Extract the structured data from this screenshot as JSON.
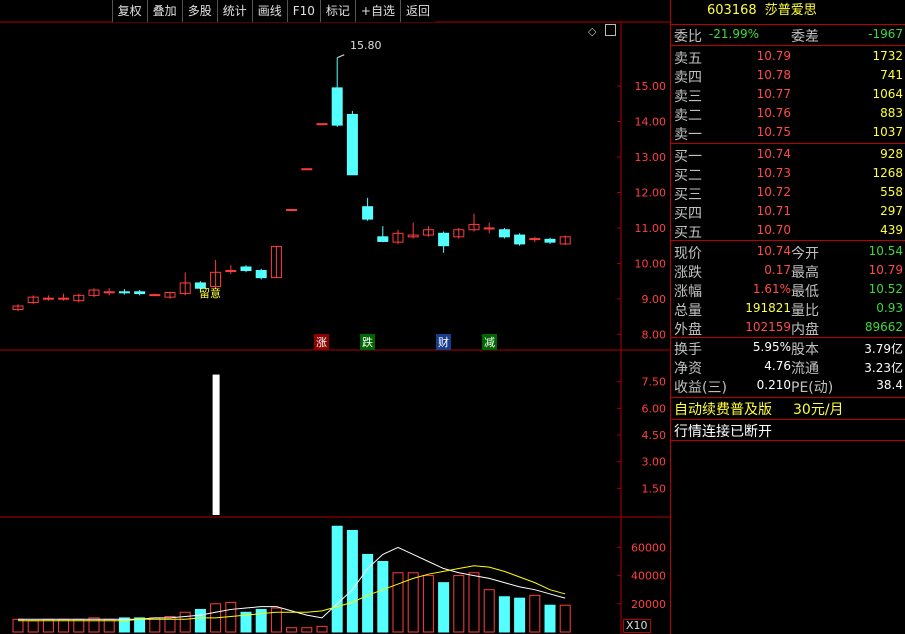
{
  "toolbar": {
    "items": [
      "复权",
      "叠加",
      "多股",
      "统计",
      "画线",
      "F10",
      "标记",
      "+自选",
      "返回"
    ]
  },
  "stock": {
    "code": "603168",
    "name": "莎普爱思"
  },
  "order_ratio": {
    "label": "委比",
    "value": "-21.99%",
    "diff_label": "委差",
    "diff_value": "-1967"
  },
  "asks": [
    {
      "label": "卖五",
      "price": "10.79",
      "vol": "1732"
    },
    {
      "label": "卖四",
      "price": "10.78",
      "vol": "741"
    },
    {
      "label": "卖三",
      "price": "10.77",
      "vol": "1064"
    },
    {
      "label": "卖二",
      "price": "10.76",
      "vol": "883"
    },
    {
      "label": "卖一",
      "price": "10.75",
      "vol": "1037"
    }
  ],
  "bids": [
    {
      "label": "买一",
      "price": "10.74",
      "vol": "928"
    },
    {
      "label": "买二",
      "price": "10.73",
      "vol": "1268"
    },
    {
      "label": "买三",
      "price": "10.72",
      "vol": "558"
    },
    {
      "label": "买四",
      "price": "10.71",
      "vol": "297"
    },
    {
      "label": "买五",
      "price": "10.70",
      "vol": "439"
    }
  ],
  "quote": [
    {
      "l1": "现价",
      "v1": "10.74",
      "c1": "red",
      "l2": "今开",
      "v2": "10.54",
      "c2": "green"
    },
    {
      "l1": "涨跌",
      "v1": "0.17",
      "c1": "red",
      "l2": "最高",
      "v2": "10.79",
      "c2": "red"
    },
    {
      "l1": "涨幅",
      "v1": "1.61%",
      "c1": "red",
      "l2": "最低",
      "v2": "10.52",
      "c2": "green"
    },
    {
      "l1": "总量",
      "v1": "191821",
      "c1": "yellow",
      "l2": "量比",
      "v2": "0.93",
      "c2": "green"
    },
    {
      "l1": "外盘",
      "v1": "102159",
      "c1": "red",
      "l2": "内盘",
      "v2": "89662",
      "c2": "green"
    }
  ],
  "fundamentals": [
    {
      "l1": "换手",
      "v1": "5.95%",
      "l2": "股本",
      "v2": "3.79亿"
    },
    {
      "l1": "净资",
      "v1": "4.76",
      "l2": "流通",
      "v2": "3.23亿"
    },
    {
      "l1": "收益(三)",
      "v1": "0.210",
      "l2": "PE(动)",
      "v2": "38.4"
    }
  ],
  "promo": {
    "text": "自动续费普及版",
    "price": "30元/月"
  },
  "status": {
    "text": "行情连接已断开"
  },
  "annotations": {
    "high_label": "15.80",
    "attention_label": "留意",
    "x10": "X10",
    "tags": [
      "涨",
      "跌",
      "财",
      "减"
    ]
  },
  "colors": {
    "up": "#ff3c3c",
    "down": "#54ffff",
    "ma1": "#ffffff",
    "ma2": "#ffff00",
    "border": "#b00000"
  },
  "chart_data": [
    {
      "type": "candlestick",
      "yticks": [
        "8.00",
        "9.00",
        "10.00",
        "11.00",
        "12.00",
        "13.00",
        "14.00",
        "15.00"
      ],
      "ylim": [
        7.7,
        16.3
      ],
      "candles": [
        {
          "o": 8.7,
          "c": 8.8,
          "h": 8.85,
          "l": 8.65
        },
        {
          "o": 8.9,
          "c": 9.05,
          "h": 9.1,
          "l": 8.85
        },
        {
          "o": 9.0,
          "c": 9.02,
          "h": 9.1,
          "l": 8.95
        },
        {
          "o": 9.02,
          "c": 9.02,
          "h": 9.15,
          "l": 8.95
        },
        {
          "o": 8.95,
          "c": 9.1,
          "h": 9.15,
          "l": 8.9
        },
        {
          "o": 9.1,
          "c": 9.25,
          "h": 9.3,
          "l": 9.05
        },
        {
          "o": 9.2,
          "c": 9.2,
          "h": 9.3,
          "l": 9.1
        },
        {
          "o": 9.2,
          "c": 9.18,
          "h": 9.28,
          "l": 9.12
        },
        {
          "o": 9.2,
          "c": 9.15,
          "h": 9.25,
          "l": 9.1
        },
        {
          "o": 9.12,
          "c": 9.12,
          "h": 9.15,
          "l": 9.08
        },
        {
          "o": 9.05,
          "c": 9.18,
          "h": 9.2,
          "l": 9.0
        },
        {
          "o": 9.15,
          "c": 9.45,
          "h": 9.75,
          "l": 9.1
        },
        {
          "o": 9.45,
          "c": 9.3,
          "h": 9.5,
          "l": 9.2
        },
        {
          "o": 9.35,
          "c": 9.75,
          "h": 10.1,
          "l": 9.3
        },
        {
          "o": 9.8,
          "c": 9.8,
          "h": 9.95,
          "l": 9.7
        },
        {
          "o": 9.9,
          "c": 9.8,
          "h": 9.95,
          "l": 9.75
        },
        {
          "o": 9.8,
          "c": 9.6,
          "h": 9.85,
          "l": 9.55
        },
        {
          "o": 9.6,
          "c": 10.48,
          "h": 10.48,
          "l": 9.6
        },
        {
          "o": 11.52,
          "c": 11.52,
          "h": 11.52,
          "l": 11.52
        },
        {
          "o": 12.67,
          "c": 12.67,
          "h": 12.67,
          "l": 12.67
        },
        {
          "o": 13.94,
          "c": 13.94,
          "h": 13.94,
          "l": 13.94
        },
        {
          "o": 14.95,
          "c": 13.9,
          "h": 15.8,
          "l": 13.85
        },
        {
          "o": 14.2,
          "c": 12.5,
          "h": 14.3,
          "l": 12.5
        },
        {
          "o": 11.6,
          "c": 11.25,
          "h": 11.85,
          "l": 11.2
        },
        {
          "o": 10.75,
          "c": 10.62,
          "h": 11.05,
          "l": 10.6
        },
        {
          "o": 10.6,
          "c": 10.85,
          "h": 10.95,
          "l": 10.55
        },
        {
          "o": 10.75,
          "c": 10.8,
          "h": 11.15,
          "l": 10.7
        },
        {
          "o": 10.8,
          "c": 10.95,
          "h": 11.05,
          "l": 10.75
        },
        {
          "o": 10.85,
          "c": 10.5,
          "h": 10.9,
          "l": 10.3
        },
        {
          "o": 10.75,
          "c": 10.95,
          "h": 11.0,
          "l": 10.7
        },
        {
          "o": 10.95,
          "c": 11.1,
          "h": 11.4,
          "l": 10.9
        },
        {
          "o": 11.0,
          "c": 11.0,
          "h": 11.15,
          "l": 10.85
        },
        {
          "o": 10.95,
          "c": 10.75,
          "h": 11.0,
          "l": 10.7
        },
        {
          "o": 10.8,
          "c": 10.55,
          "h": 10.85,
          "l": 10.5
        },
        {
          "o": 10.7,
          "c": 10.7,
          "h": 10.75,
          "l": 10.6
        },
        {
          "o": 10.68,
          "c": 10.6,
          "h": 10.72,
          "l": 10.55
        },
        {
          "o": 10.55,
          "c": 10.75,
          "h": 10.79,
          "l": 10.52
        }
      ]
    },
    {
      "type": "bar",
      "yticks": [
        "1.50",
        "3.00",
        "4.50",
        "6.00",
        "7.50"
      ],
      "ylim": [
        0,
        9
      ],
      "bars": [
        {
          "index": 13,
          "value": 7.9
        }
      ]
    },
    {
      "type": "bar",
      "yticks": [
        "20000",
        "40000",
        "60000"
      ],
      "ylim": [
        0,
        78000
      ],
      "volumes": [
        9000,
        8000,
        9000,
        9000,
        9000,
        10000,
        9000,
        10000,
        10000,
        10000,
        11000,
        14000,
        16000,
        20000,
        21000,
        14000,
        16000,
        17000,
        3000,
        3000,
        4000,
        75000,
        72000,
        55000,
        50000,
        42000,
        42000,
        40000,
        35000,
        40000,
        42000,
        30000,
        25000,
        24000,
        26000,
        19000,
        19000
      ],
      "ma1": [
        9000,
        9000,
        9000,
        9000,
        9000,
        9000,
        9000,
        9000,
        9000,
        10000,
        10000,
        11000,
        12000,
        14000,
        16000,
        17000,
        18000,
        18000,
        15000,
        12000,
        10000,
        20000,
        30000,
        45000,
        55000,
        60000,
        55000,
        50000,
        45000,
        42000,
        40000,
        38000,
        35000,
        32000,
        30000,
        27000,
        24000
      ],
      "ma2": [
        8000,
        8000,
        8000,
        8000,
        8000,
        8000,
        8000,
        8000,
        9000,
        9000,
        9000,
        9000,
        10000,
        10000,
        11000,
        12000,
        13000,
        14000,
        14000,
        14000,
        15000,
        18000,
        21000,
        26000,
        30000,
        34000,
        38000,
        41000,
        43000,
        45000,
        47000,
        46000,
        43000,
        39000,
        35000,
        30000,
        27000
      ]
    }
  ]
}
